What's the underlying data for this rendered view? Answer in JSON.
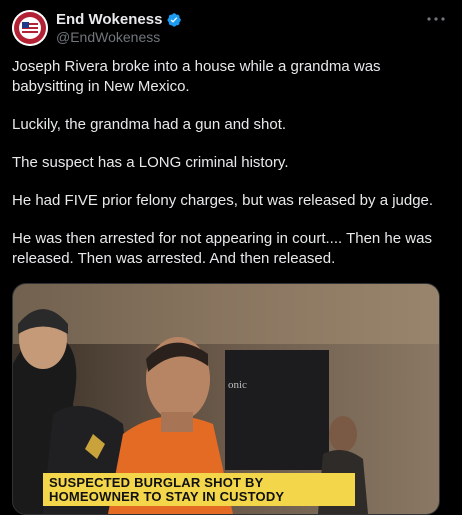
{
  "author": {
    "name": "End Wokeness",
    "handle": "@EndWokeness",
    "verified": true,
    "verified_icon": "verified-badge-icon"
  },
  "more_icon": "more-options-icon",
  "tweet": {
    "paragraphs": [
      "Joseph Rivera broke into a house while a grandma was babysitting in New Mexico.",
      "Luckily, the grandma had a gun and shot.",
      "The suspect has a LONG criminal history.",
      "He had FIVE prior felony charges, but was released by a judge.",
      "He was then arrested for not appearing in court.... Then he was released. Then was arrested. And then released."
    ]
  },
  "media": {
    "chyron_line1": "SUSPECTED BURGLAR SHOT BY",
    "chyron_line2": "HOMEOWNER TO STAY IN CUSTODY",
    "monitor_label": "onic"
  },
  "colors": {
    "background": "#000000",
    "text": "#e7e9ea",
    "secondary": "#71767b",
    "verified": "#1d9bf0",
    "chyron": "#f3d64a"
  }
}
